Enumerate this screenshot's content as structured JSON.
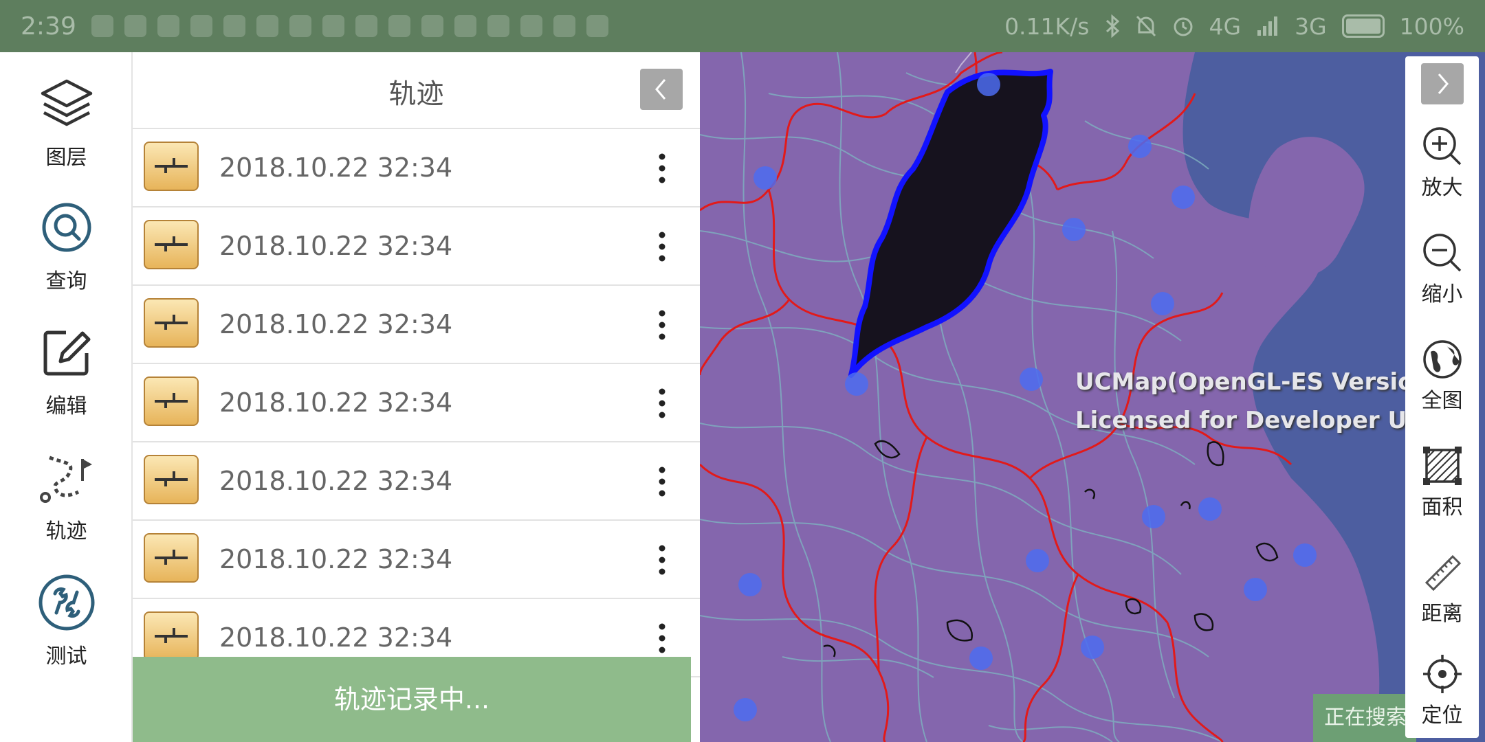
{
  "status_bar": {
    "time": "2:39",
    "net_speed": "0.11K/s",
    "signal_1": "4G",
    "signal_2": "3G",
    "battery": "100%",
    "battery_level": 1.0
  },
  "left_toolbar": {
    "items": [
      {
        "label": "图层",
        "icon": "layers-icon"
      },
      {
        "label": "查询",
        "icon": "search-icon"
      },
      {
        "label": "编辑",
        "icon": "edit-icon"
      },
      {
        "label": "轨迹",
        "icon": "track-icon"
      },
      {
        "label": "测试",
        "icon": "wrench-icon"
      }
    ]
  },
  "track_panel": {
    "title": "轨迹",
    "collapse_icon": "chevron-left-icon",
    "rows": [
      {
        "text": "2018.10.22 32:34"
      },
      {
        "text": "2018.10.22 32:34"
      },
      {
        "text": "2018.10.22 32:34"
      },
      {
        "text": "2018.10.22 32:34"
      },
      {
        "text": "2018.10.22 32:34"
      },
      {
        "text": "2018.10.22 32:34"
      },
      {
        "text": "2018.10.22 32:34"
      }
    ],
    "recording_label": "轨迹记录中..."
  },
  "map": {
    "watermark_line1": "UCMap(OpenGL-ES Version)",
    "watermark_line2": "Licensed for Developer Use",
    "searching_label": "正在搜索",
    "colors": {
      "background": "#8466ad",
      "province_border": "#e21a1a",
      "rivers": "#7fb2c0",
      "highlight_fill": "#16121e",
      "highlight_border": "#1212ff",
      "points": "#4c6cf0",
      "sea": "#4d5ea0"
    }
  },
  "right_toolbar": {
    "expand_icon": "chevron-right-icon",
    "items": [
      {
        "label": "放大",
        "icon": "zoom-in-icon"
      },
      {
        "label": "缩小",
        "icon": "zoom-out-icon"
      },
      {
        "label": "全图",
        "icon": "globe-icon"
      },
      {
        "label": "面积",
        "icon": "area-icon"
      },
      {
        "label": "距离",
        "icon": "ruler-icon"
      },
      {
        "label": "定位",
        "icon": "locate-icon"
      }
    ]
  }
}
